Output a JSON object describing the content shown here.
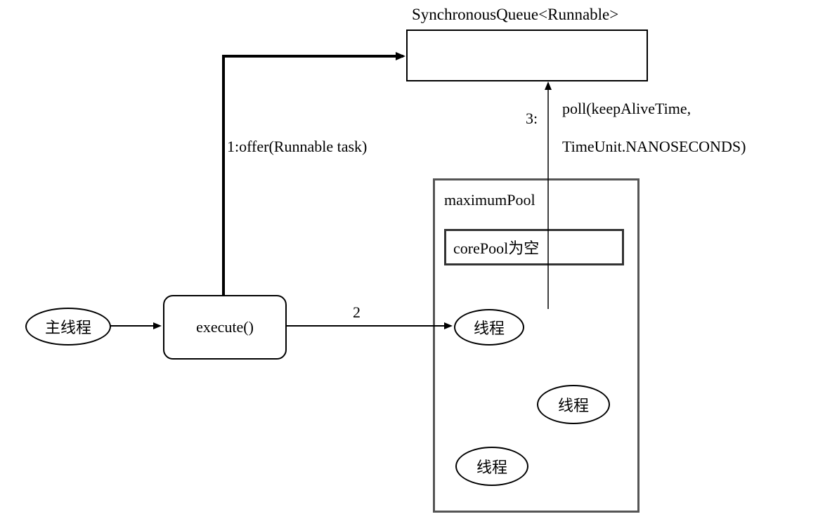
{
  "nodes": {
    "main_thread": "主线程",
    "execute": "execute()",
    "queue_title": "SynchronousQueue<Runnable>",
    "maximum_pool": "maximumPool",
    "core_pool": "corePool为空",
    "thread1": "线程",
    "thread2": "线程",
    "thread3": "线程"
  },
  "edges": {
    "edge1": "1:offer(Runnable task)",
    "edge2": "2",
    "edge3_num": "3:",
    "edge3_line1": "poll(keepAliveTime,",
    "edge3_line2": "TimeUnit.NANOSECONDS)"
  }
}
